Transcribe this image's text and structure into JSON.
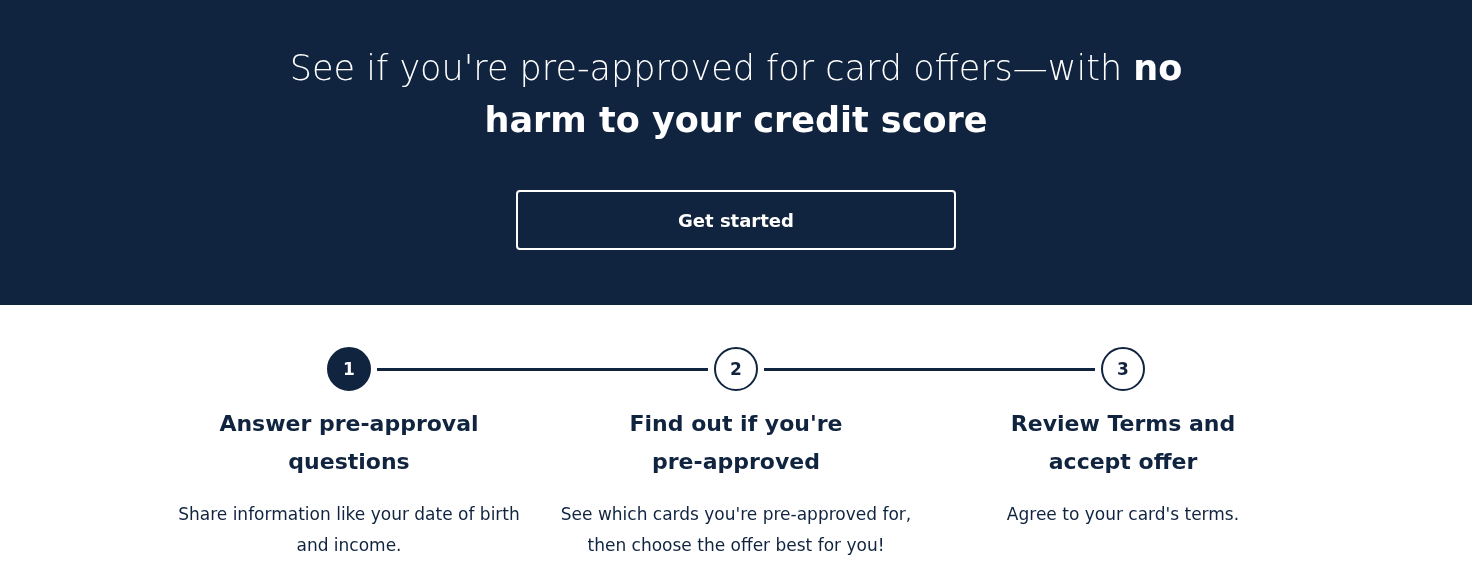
{
  "hero": {
    "headline": "See if you're pre-approved for card offers—with **no harm to your credit score**",
    "button": "Get started"
  },
  "steps": [
    {
      "number": "1",
      "active": true,
      "title": "Answer pre-approval questions",
      "description": "Share information like your date of birth and income."
    },
    {
      "number": "2",
      "active": false,
      "title": "Find out if you're pre-approved",
      "description": "See which cards you're pre-approved for, then choose the offer best for you!"
    },
    {
      "number": "3",
      "active": false,
      "title": "Review Terms and accept offer",
      "description": "Agree to your card's terms."
    }
  ]
}
